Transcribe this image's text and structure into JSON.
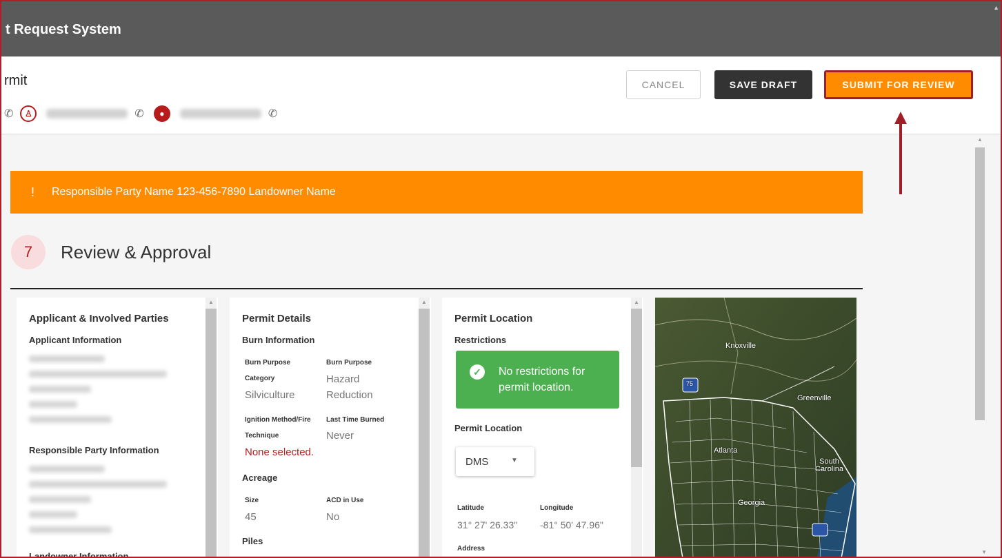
{
  "app": {
    "title": "t Request System"
  },
  "header": {
    "page_title": "rmit",
    "actions": {
      "cancel": "CANCEL",
      "save_draft": "SAVE DRAFT",
      "submit": "SUBMIT FOR REVIEW"
    }
  },
  "alert": {
    "icon": "!",
    "text": "Responsible Party Name 123-456-7890 Landowner Name"
  },
  "step": {
    "number": "7",
    "title": "Review & Approval"
  },
  "panels": {
    "applicant": {
      "title": "Applicant & Involved Parties",
      "applicant_info": "Applicant Information",
      "responsible_info": "Responsible Party Information",
      "landowner_info": "Landowner Information"
    },
    "permit_details": {
      "title": "Permit Details",
      "burn_info": "Burn Information",
      "burn_purpose_label": "Burn Purpose",
      "category_label": "Category",
      "category_value": "Silviculture",
      "burn_purpose_label2": "Burn Purpose",
      "burn_purpose_value": "Hazard Reduction",
      "burn_purpose_value_line1": "Hazard",
      "burn_purpose_value_line2": "Reduction",
      "ignition_label": "Ignition Method/Fire",
      "technique_label": "Technique",
      "ignition_value": "None selected.",
      "last_burned_label": "Last Time Burned",
      "last_burned_value": "Never",
      "acreage": "Acreage",
      "size_label": "Size",
      "size_value": "45",
      "acd_label": "ACD in Use",
      "acd_value": "No",
      "piles": "Piles"
    },
    "permit_location": {
      "title": "Permit Location",
      "restrictions": "Restrictions",
      "restriction_msg": "No restrictions for permit location.",
      "location_label": "Permit Location",
      "format_value": "DMS",
      "latitude_label": "Latitude",
      "latitude_value": "31° 27' 26.33\"",
      "longitude_label": "Longitude",
      "longitude_value": "-81° 50' 47.96\"",
      "address_label": "Address"
    },
    "map": {
      "labels": {
        "knoxville": "Knoxville",
        "greenville": "Greenville",
        "south_carolina": "South\nCarolina",
        "georgia": "Georgia",
        "atlanta": "Atlanta",
        "i75": "75"
      }
    }
  },
  "colors": {
    "accent": "#ff8c00",
    "brand_red": "#b71c1c",
    "success": "#4caf50",
    "dark": "#333333"
  }
}
